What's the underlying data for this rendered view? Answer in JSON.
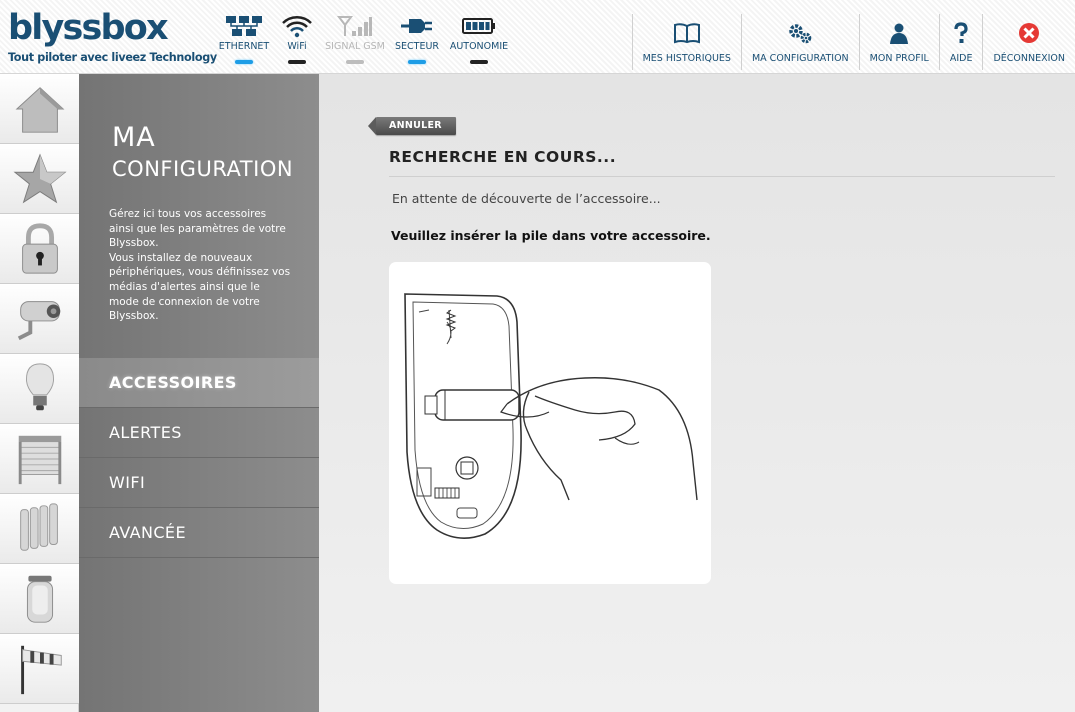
{
  "logo": {
    "name": "blyssbox",
    "tagline": "Tout piloter avec liveez Technology"
  },
  "status": [
    {
      "label": "ETHERNET",
      "state": "active",
      "icon": "network-icon"
    },
    {
      "label": "WiFi",
      "state": "ok",
      "icon": "wifi-icon"
    },
    {
      "label": "SIGNAL GSM",
      "state": "inactive",
      "icon": "signal-icon"
    },
    {
      "label": "SECTEUR",
      "state": "active",
      "icon": "plug-icon"
    },
    {
      "label": "AUTONOMIE",
      "state": "ok",
      "icon": "battery-icon"
    }
  ],
  "topnav": [
    {
      "label": "MES HISTORIQUES",
      "icon": "book-icon"
    },
    {
      "label": "MA CONFIGURATION",
      "icon": "gears-icon"
    },
    {
      "label": "MON PROFIL",
      "icon": "user-icon"
    },
    {
      "label": "AIDE",
      "icon": "question-icon"
    },
    {
      "label": "DÉCONNEXION",
      "icon": "close-icon"
    }
  ],
  "rail": [
    "home-icon",
    "star-icon",
    "padlock-icon",
    "camera-icon",
    "bulb-icon",
    "shutter-icon",
    "radiator-icon",
    "sensor-icon",
    "windsock-icon"
  ],
  "side": {
    "title_line1": "MA",
    "title_line2": "CONFIGURATION",
    "description": [
      "Gérez ici tous vos accessoires",
      "ainsi que les paramètres de votre",
      "Blyssbox.",
      "Vous installez de nouveaux",
      "périphériques, vous définissez vos",
      "médias d'alertes ainsi que le",
      "mode de connexion de votre",
      "Blyssbox."
    ],
    "menu": [
      {
        "label": "ACCESSOIRES",
        "active": true
      },
      {
        "label": "ALERTES",
        "active": false
      },
      {
        "label": "WIFI",
        "active": false
      },
      {
        "label": "AVANCÉE",
        "active": false
      }
    ]
  },
  "main": {
    "cancel_label": "ANNULER",
    "title": "RECHERCHE EN COURS...",
    "waiting": "En attente de découverte de l’accessoire...",
    "instruction": "Veuillez insérer la pile dans votre accessoire."
  },
  "colors": {
    "brand": "#1a4f74",
    "active_indicator": "#1e9de6",
    "close": "#e53935"
  }
}
